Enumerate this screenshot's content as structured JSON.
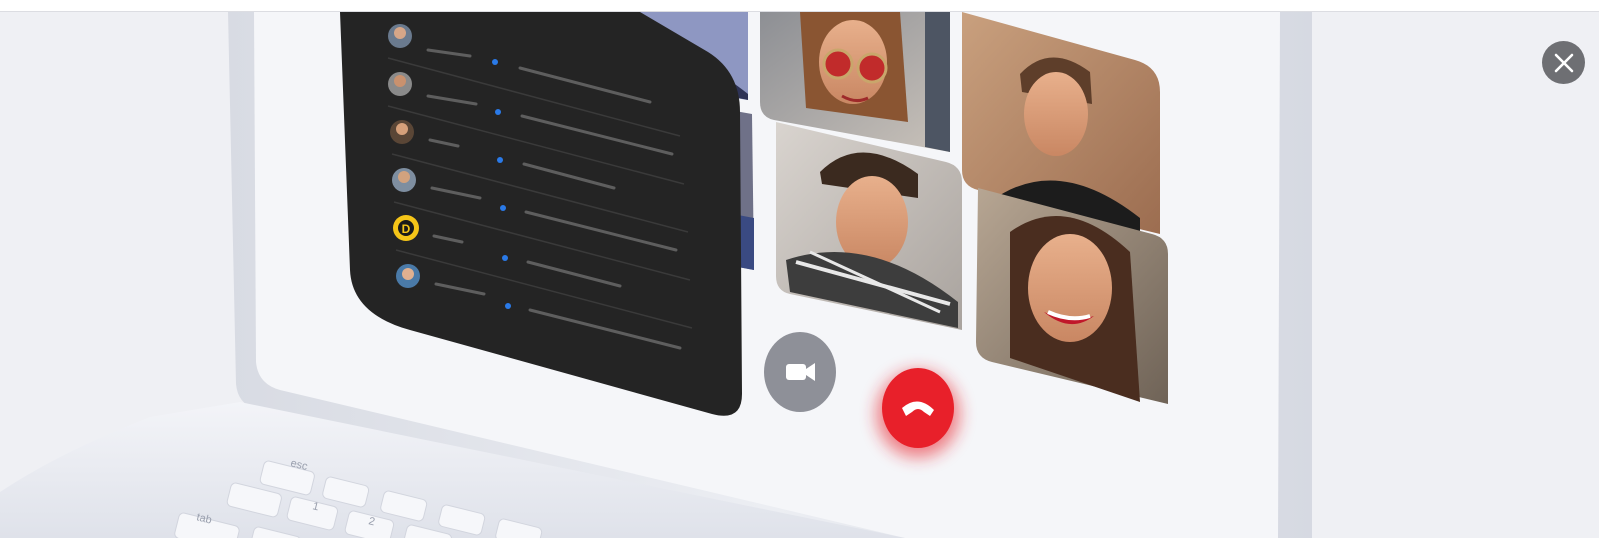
{
  "overlay": {
    "close_icon": "close-icon"
  },
  "video_call_mockup": {
    "participant_list": {
      "avatars": [
        "avatar-man-1",
        "avatar-man-2",
        "avatar-man-3",
        "avatar-man-4",
        "avatar-letter-d",
        "avatar-woman"
      ],
      "letter_avatar_text": "D",
      "letter_avatar_color": "#f5c518"
    },
    "video_tiles": [
      "woman-sunglasses",
      "young-man",
      "man-plaid-shirt",
      "smiling-woman",
      "partial-man",
      "partial-person"
    ],
    "controls": {
      "camera_icon": "video-camera-icon",
      "camera_button_color": "#8e9098",
      "hangup_icon": "phone-hangup-icon",
      "hangup_button_color": "#e8202a"
    }
  },
  "keyboard": {
    "keys": [
      "esc",
      "tab",
      "1",
      "2",
      "@"
    ]
  },
  "colors": {
    "panel_dark": "#242424",
    "accent_blue": "#2a7ae8",
    "laptop_silver": "#dfe2ea",
    "background": "#eff0f4"
  }
}
